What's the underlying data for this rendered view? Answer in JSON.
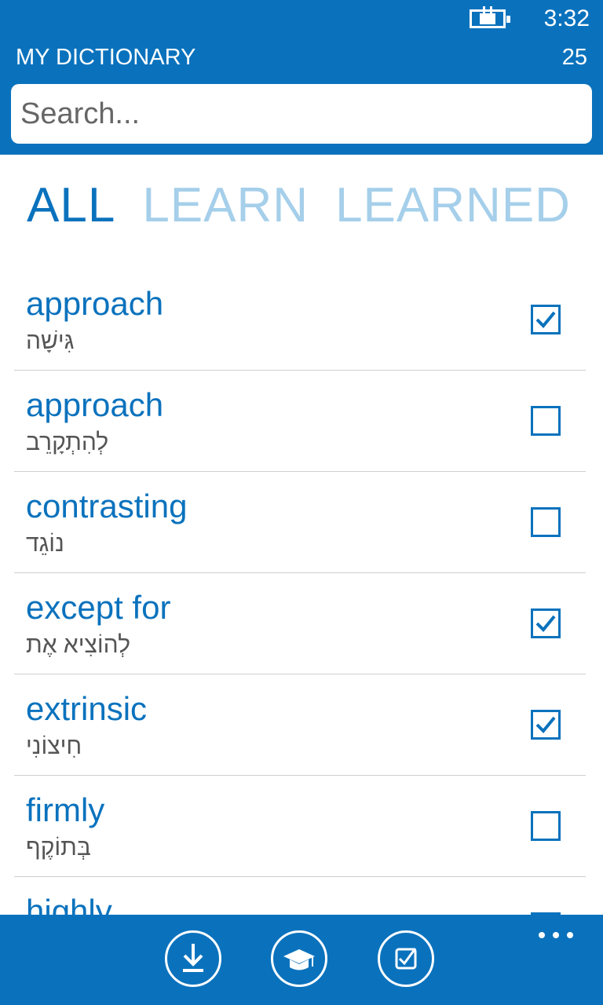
{
  "status": {
    "time": "3:32"
  },
  "header": {
    "title": "MY DICTIONARY",
    "count": "25"
  },
  "search": {
    "placeholder": "Search..."
  },
  "tabs": [
    {
      "label": "ALL",
      "active": true
    },
    {
      "label": "LEARN",
      "active": false
    },
    {
      "label": "LEARNED",
      "active": false
    }
  ],
  "entries": [
    {
      "word": "approach",
      "translation": "גִּישָׁה",
      "checked": true
    },
    {
      "word": "approach",
      "translation": "לְהִתְקָרֵב",
      "checked": false
    },
    {
      "word": "contrasting",
      "translation": "נוֹגֵד",
      "checked": false
    },
    {
      "word": "except for",
      "translation": "לְהוֹצִיא אֶת",
      "checked": true
    },
    {
      "word": "extrinsic",
      "translation": "חִיצוֹנִי",
      "checked": true
    },
    {
      "word": "firmly",
      "translation": "בְּתוֹקֶף",
      "checked": false
    },
    {
      "word": "highly",
      "translation": "",
      "checked": false
    }
  ],
  "appbar": {
    "buttons": [
      "download-icon",
      "graduation-cap-icon",
      "checkbox-icon"
    ],
    "more": "ellipsis-icon"
  },
  "colors": {
    "accent": "#0a72bd",
    "inactive_tab": "#a5cfea"
  }
}
